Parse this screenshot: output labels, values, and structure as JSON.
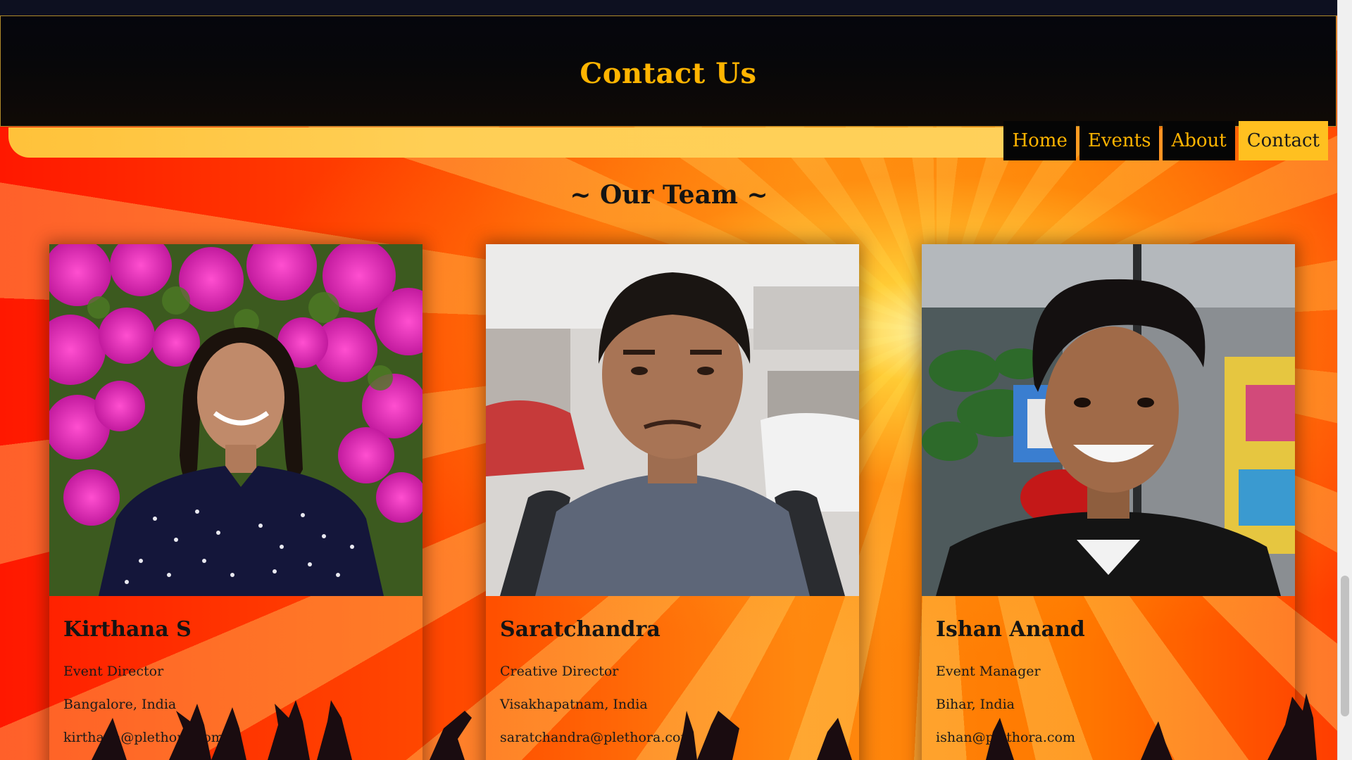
{
  "header": {
    "title": "Contact Us"
  },
  "nav": {
    "items": [
      {
        "label": "Home",
        "active": false
      },
      {
        "label": "Events",
        "active": false
      },
      {
        "label": "About",
        "active": false
      },
      {
        "label": "Contact",
        "active": true
      }
    ]
  },
  "team": {
    "heading": "~ Our Team ~",
    "members": [
      {
        "name": "Kirthana S",
        "role": "Event Director",
        "location": "Bangalore, India",
        "email": "kirthana@plethora.com",
        "photo": "portrait-photo"
      },
      {
        "name": "Saratchandra",
        "role": "Creative Director",
        "location": "Visakhapatnam, India",
        "email": "saratchandra@plethora.com",
        "photo": "portrait-photo"
      },
      {
        "name": "Ishan Anand",
        "role": "Event Manager",
        "location": "Bihar, India",
        "email": "ishan@plethora.com",
        "photo": "portrait-photo"
      }
    ]
  },
  "colors": {
    "accent": "#ffb400",
    "header_bg": "#05060d",
    "nav_bg": "#050505",
    "nav_active_bg": "#ffc020"
  }
}
